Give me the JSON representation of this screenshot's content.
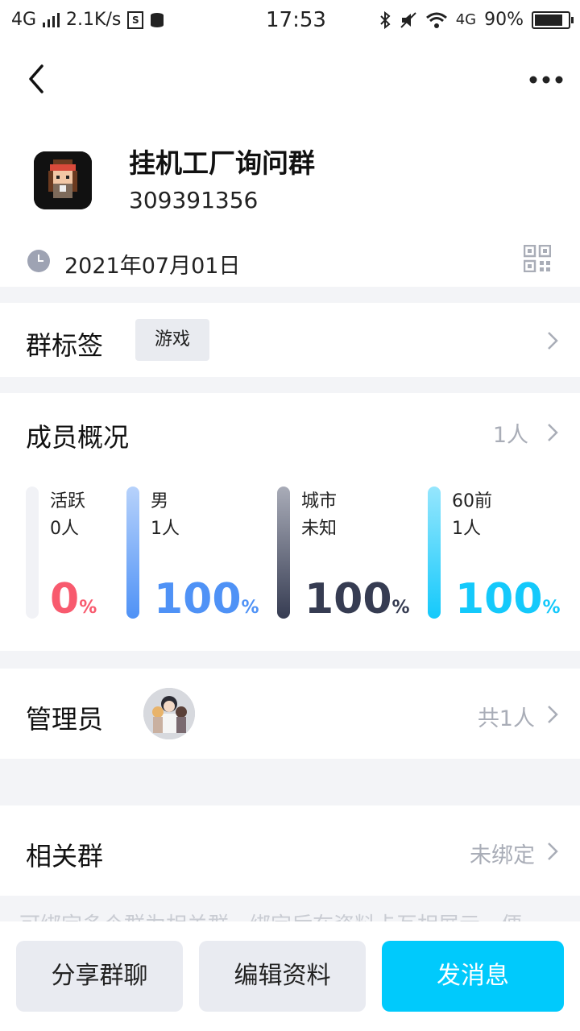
{
  "status_bar": {
    "network": "4G",
    "speed": "2.1K/s",
    "time": "17:53",
    "network_right": "4G",
    "battery": "90%",
    "battery_level": 0.9
  },
  "header": {
    "group_name": "挂机工厂询问群",
    "group_id": "309391356",
    "created_date": "2021年07月01日"
  },
  "tags_section": {
    "title": "群标签",
    "tag": "游戏"
  },
  "members_section": {
    "title": "成员概况",
    "count": "1人",
    "stats": [
      {
        "label": "活跃",
        "sub": "0人",
        "percent": "0",
        "unit": "%",
        "color": "#f85a6e",
        "bar_top": "#f1f2f6",
        "bar_bottom": "#f1f2f6"
      },
      {
        "label": "男",
        "sub": "1人",
        "percent": "100",
        "unit": "%",
        "color": "#4f92f6",
        "bar_top": "#b7d2fb",
        "bar_bottom": "#4f92f6"
      },
      {
        "label": "城市",
        "sub": "未知",
        "percent": "100",
        "unit": "%",
        "color": "#363c52",
        "bar_top": "#a9acb8",
        "bar_bottom": "#363c52"
      },
      {
        "label": "60前",
        "sub": "1人",
        "percent": "100",
        "unit": "%",
        "color": "#14c9fb",
        "bar_top": "#96e6fd",
        "bar_bottom": "#14c9fb"
      }
    ]
  },
  "admin_section": {
    "title": "管理员",
    "count": "共1人"
  },
  "related_section": {
    "title": "相关群",
    "status": "未绑定",
    "hint": "可绑定多个群为相关群，绑定后在资料卡互相展示，便"
  },
  "bottom_bar": {
    "share": "分享群聊",
    "edit": "编辑资料",
    "send": "发消息"
  }
}
